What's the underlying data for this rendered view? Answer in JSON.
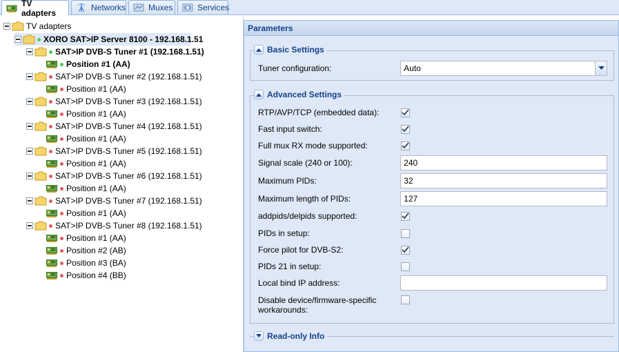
{
  "tabs": [
    {
      "label": "TV adapters",
      "icon": "tv-card-icon",
      "active": true
    },
    {
      "label": "Networks",
      "icon": "antenna-icon",
      "active": false
    },
    {
      "label": "Muxes",
      "icon": "muxes-icon",
      "active": false
    },
    {
      "label": "Services",
      "icon": "services-icon",
      "active": false
    }
  ],
  "tree": {
    "root": "TV adapters",
    "server": "XORO SAT>IP Server 8100 - 192.168.1.51",
    "tuners": [
      {
        "label": "SAT>IP DVB-S Tuner #1 (192.168.1.51)",
        "positions": [
          "Position #1 (AA)"
        ]
      },
      {
        "label": "SAT>IP DVB-S Tuner #2 (192.168.1.51)",
        "positions": [
          "Position #1 (AA)"
        ]
      },
      {
        "label": "SAT>IP DVB-S Tuner #3 (192.168.1.51)",
        "positions": [
          "Position #1 (AA)"
        ]
      },
      {
        "label": "SAT>IP DVB-S Tuner #4 (192.168.1.51)",
        "positions": [
          "Position #1 (AA)"
        ]
      },
      {
        "label": "SAT>IP DVB-S Tuner #5 (192.168.1.51)",
        "positions": [
          "Position #1 (AA)"
        ]
      },
      {
        "label": "SAT>IP DVB-S Tuner #6 (192.168.1.51)",
        "positions": [
          "Position #1 (AA)"
        ]
      },
      {
        "label": "SAT>IP DVB-S Tuner #7 (192.168.1.51)",
        "positions": [
          "Position #1 (AA)"
        ]
      },
      {
        "label": "SAT>IP DVB-S Tuner #8 (192.168.1.51)",
        "positions": [
          "Position #1 (AA)",
          "Position #2 (AB)",
          "Position #3 (BA)",
          "Position #4 (BB)"
        ]
      }
    ]
  },
  "params": {
    "title": "Parameters",
    "basic": {
      "legend": "Basic Settings",
      "tuner_config_label": "Tuner configuration:",
      "tuner_config_value": "Auto"
    },
    "advanced": {
      "legend": "Advanced Settings",
      "rtp_label": "RTP/AVP/TCP (embedded data):",
      "rtp_checked": true,
      "fast_switch_label": "Fast input switch:",
      "fast_switch_checked": true,
      "full_mux_label": "Full mux RX mode supported:",
      "full_mux_checked": true,
      "signal_scale_label": "Signal scale (240 or 100):",
      "signal_scale_value": "240",
      "max_pids_label": "Maximum PIDs:",
      "max_pids_value": "32",
      "max_len_label": "Maximum length of PIDs:",
      "max_len_value": "127",
      "addpids_label": "addpids/delpids supported:",
      "addpids_checked": true,
      "pids_setup_label": "PIDs in setup:",
      "pids_setup_checked": false,
      "force_pilot_label": "Force pilot for DVB-S2:",
      "force_pilot_checked": true,
      "pids21_label": "PIDs 21 in setup:",
      "pids21_checked": false,
      "local_ip_label": "Local bind IP address:",
      "local_ip_value": "",
      "disable_workarounds_label": "Disable device/firmware-specific workarounds:",
      "disable_workarounds_checked": false
    },
    "readonly": {
      "legend": "Read-only Info"
    }
  },
  "colors": {
    "accent": "#15428b",
    "panel_bg": "#dfe8f6",
    "border": "#99bbe8",
    "status_ok": "#4cc94c",
    "status_off": "#e25a5a"
  }
}
